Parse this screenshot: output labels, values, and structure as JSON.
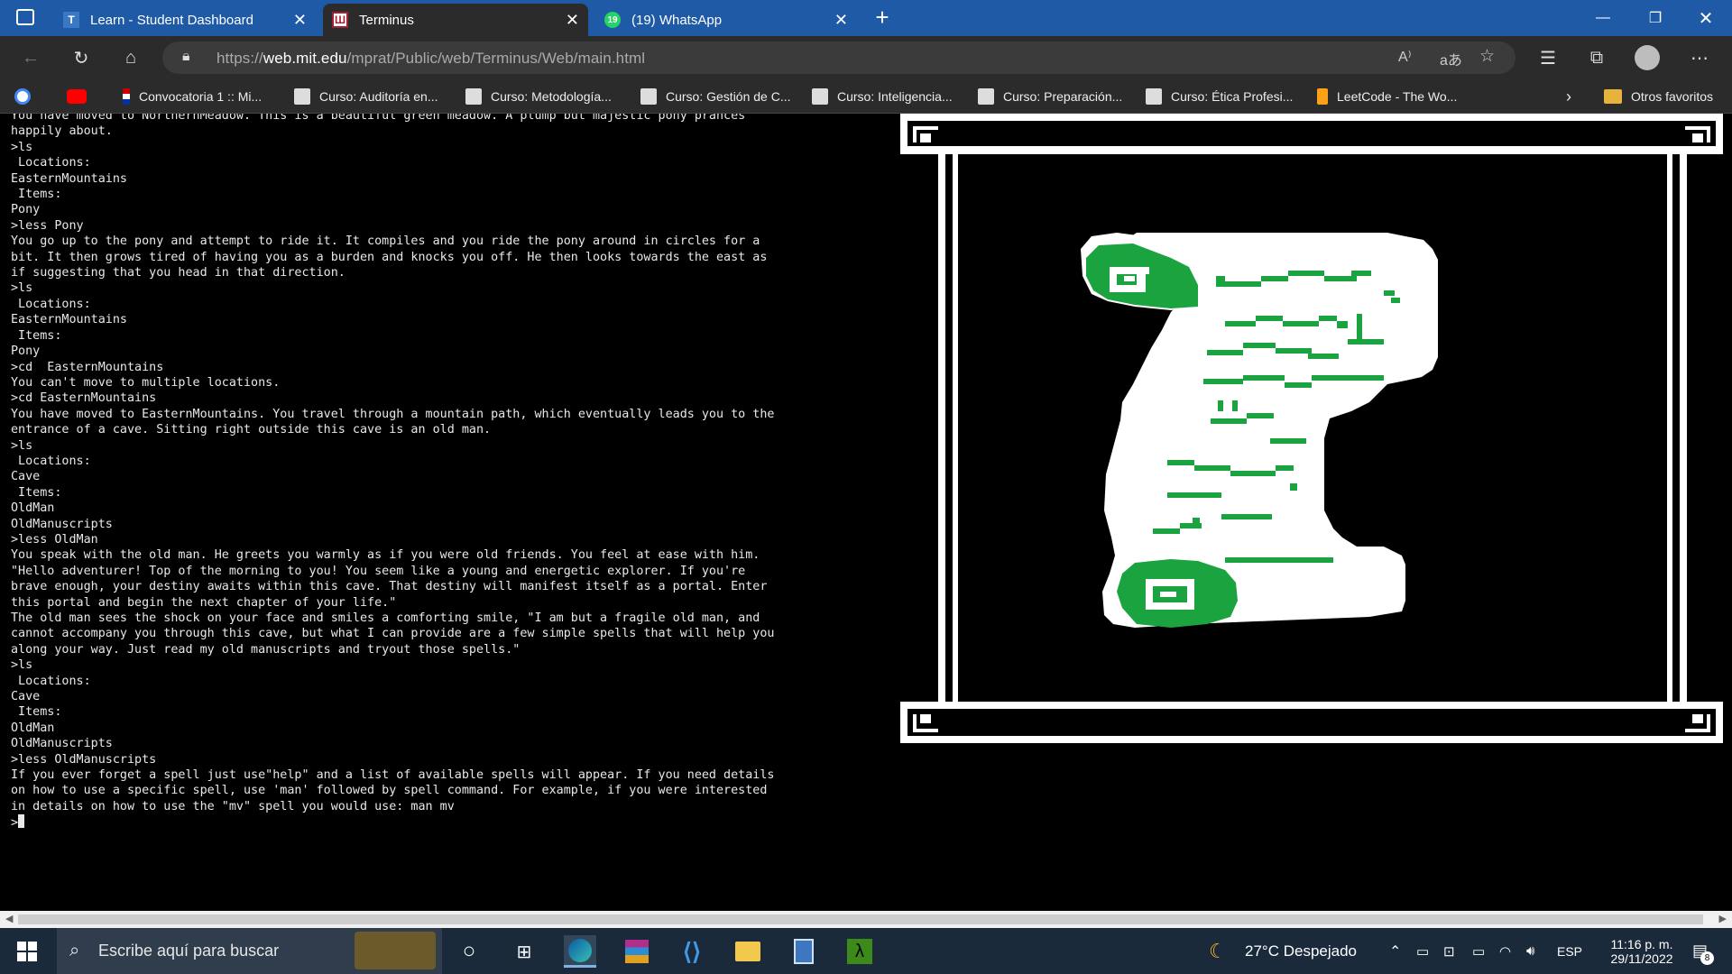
{
  "browser": {
    "tabs": [
      {
        "label": "Learn - Student Dashboard",
        "icon": "learn-icon"
      },
      {
        "label": "Terminus",
        "icon": "terminus-icon"
      },
      {
        "label": "(19) WhatsApp",
        "icon": "whatsapp-icon"
      }
    ],
    "url_prefix": "https://",
    "url_host": "web.mit.edu",
    "url_path": "/mprat/Public/web/Terminus/Web/main.html",
    "bookmarks": [
      {
        "label": "",
        "icon": "google-icon"
      },
      {
        "label": "",
        "icon": "youtube-icon"
      },
      {
        "label": "Convocatoria 1 :: Mi...",
        "icon": "flag-icon"
      },
      {
        "label": "Curso: Auditoría en...",
        "icon": "course-icon"
      },
      {
        "label": "Curso: Metodología...",
        "icon": "course-icon"
      },
      {
        "label": "Curso: Gestión de C...",
        "icon": "course-icon"
      },
      {
        "label": "Curso: Inteligencia...",
        "icon": "course-icon"
      },
      {
        "label": "Curso: Preparación...",
        "icon": "course-icon"
      },
      {
        "label": "Curso: Ética Profesi...",
        "icon": "course-icon"
      },
      {
        "label": "LeetCode - The Wo...",
        "icon": "leetcode-icon"
      }
    ],
    "other_favorites": "Otros favoritos"
  },
  "terminal": {
    "lines": [
      "You have moved to NorthernMeadow. This is a beautiful green meadow. A plump but majestic pony prances",
      "happily about.",
      ">ls",
      " Locations:",
      "EasternMountains",
      " Items:",
      "Pony",
      ">less Pony",
      "You go up to the pony and attempt to ride it. It compiles and you ride the pony around in circles for a",
      "bit. It then grows tired of having you as a burden and knocks you off. He then looks towards the east as",
      "if suggesting that you head in that direction.",
      ">ls",
      " Locations:",
      "EasternMountains",
      " Items:",
      "Pony",
      ">cd  EasternMountains",
      "You can't move to multiple locations.",
      ">cd EasternMountains",
      "You have moved to EasternMountains. You travel through a mountain path, which eventually leads you to the",
      "entrance of a cave. Sitting right outside this cave is an old man.",
      ">ls",
      " Locations:",
      "Cave",
      " Items:",
      "OldMan",
      "OldManuscripts",
      ">less OldMan",
      "You speak with the old man. He greets you warmly as if you were old friends. You feel at ease with him.",
      "\"Hello adventurer! Top of the morning to you! You seem like a young and energetic explorer. If you're",
      "brave enough, your destiny awaits within this cave. That destiny will manifest itself as a portal. Enter",
      "this portal and begin the next chapter of your life.\"",
      "The old man sees the shock on your face and smiles a comforting smile, \"I am but a fragile old man, and",
      "cannot accompany you through this cave, but what I can provide are a few simple spells that will help you",
      "along your way. Just read my old manuscripts and tryout those spells.\"",
      ">ls",
      " Locations:",
      "Cave",
      " Items:",
      "OldMan",
      "OldManuscripts",
      ">less OldManuscripts",
      "If you ever forget a spell just use\"help\" and a list of available spells will appear. If you need details",
      "on how to use a specific spell, use 'man' followed by spell command. For example, if you were interested",
      "in details on how to use the \"mv\" spell you would use: man mv"
    ],
    "prompt": ">"
  },
  "taskbar": {
    "search_placeholder": "Escribe aquí para buscar",
    "weather": "27°C  Despejado",
    "language": "ESP",
    "time": "11:16 p. m.",
    "date": "29/11/2022",
    "notifications": "8"
  },
  "colors": {
    "tabbar": "#1f5aa6",
    "toolbar": "#2b2b2b",
    "scroll_green": "#1aa33f",
    "taskbar": "#1b2a3a"
  }
}
